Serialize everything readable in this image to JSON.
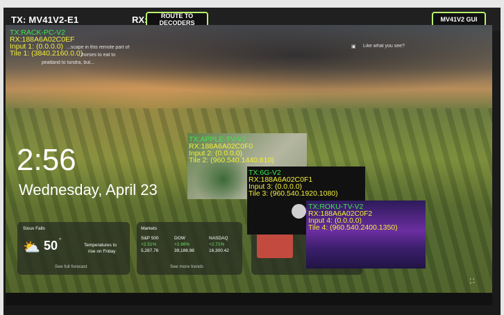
{
  "header": {
    "tx_text": "TX:  MV41V2-E1",
    "rx_text": "RX:",
    "route_button": "ROUTE TO DECODERS",
    "gui_button": "MV41V2 GUI"
  },
  "overlays": {
    "base": {
      "tx": "TX:RACK-PC-V2",
      "rx": "RX:188A6A02C0EF",
      "input": "Input 1: (0.0.0.0)",
      "tile": "Tile 1: (3840.2160.0.0)"
    },
    "apple": {
      "tx": "TX:APPLE-TV-V2",
      "rx": "RX:188A6A02C0F0",
      "input": "Input 2: (0.0.0.0)",
      "tile": "Tile 2: (960.540.1440.810)"
    },
    "sixg": {
      "tx": "TX:6G-V2",
      "rx": "RX:188A6A02C0F1",
      "input": "Input 3: (0.0.0.0)",
      "tile": "Tile 3: (960.540.1920.1080)"
    },
    "roku": {
      "tx": "TX:ROKU-TV-V2",
      "rx": "RX:188A6A02C0F2",
      "input": "Input 4: (0.0.0.0)",
      "tile": "Tile 4: (960.540.2400.1350)"
    }
  },
  "lockscreen": {
    "time": "2:56",
    "date": "Wednesday, April 23",
    "caption_line1": "...scape in this remote part of",
    "caption_line2": "...horses to eat to",
    "caption_line3": "peatland to tundra, but...",
    "like_text": "Like what you see?",
    "weather": {
      "city": "Sioux Falls",
      "temp": "50",
      "unit": "°",
      "note_line1": "Temperatures to",
      "note_line2": "rise on Friday",
      "link": "See full forecast"
    },
    "markets": {
      "title": "Markets",
      "cols": [
        {
          "name": "S&P 500",
          "change": "+2.51%",
          "value": "5,287.76"
        },
        {
          "name": "DOW",
          "change": "+2.66%",
          "value": "39,186.98"
        },
        {
          "name": "NASDAQ",
          "change": "+2.71%",
          "value": "16,300.42"
        }
      ],
      "link": "See more trends"
    }
  },
  "colors": {
    "accent": "#b9f36b",
    "overlay_green": "#3ee84b",
    "overlay_yellow": "#f4f03a"
  }
}
